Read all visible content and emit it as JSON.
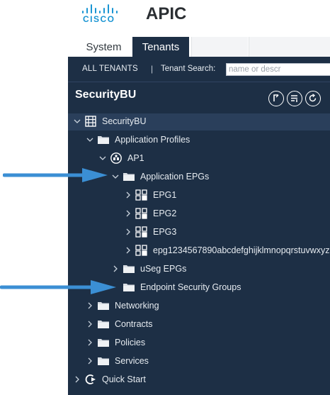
{
  "header": {
    "brand": "CISCO",
    "app_title": "APIC"
  },
  "tabs": [
    {
      "label": "System",
      "active": false
    },
    {
      "label": "Tenants",
      "active": true
    }
  ],
  "subbar": {
    "all_tenants": "ALL TENANTS",
    "separator": "|",
    "tenant_search_label": "Tenant Search:",
    "search_placeholder": "name or descr"
  },
  "panel": {
    "title": "SecurityBU",
    "actions": [
      "summary-icon",
      "list-icon",
      "refresh-icon"
    ]
  },
  "tree": {
    "root": {
      "label": "SecurityBU",
      "icon": "tenant-building-icon"
    },
    "application_profiles": {
      "label": "Application Profiles",
      "icon": "folder-icon"
    },
    "ap1": {
      "label": "AP1",
      "icon": "application-profile-icon"
    },
    "application_epgs": {
      "label": "Application EPGs",
      "icon": "folder-icon"
    },
    "epgs": [
      {
        "label": "EPG1",
        "icon": "epg-icon"
      },
      {
        "label": "EPG2",
        "icon": "epg-icon"
      },
      {
        "label": "EPG3",
        "icon": "epg-icon"
      },
      {
        "label": "epg1234567890abcdefghijklmnopqrstuvwxyz",
        "icon": "epg-icon"
      }
    ],
    "useg_epgs": {
      "label": "uSeg EPGs",
      "icon": "folder-icon"
    },
    "endpoint_security_groups": {
      "label": "Endpoint Security Groups",
      "icon": "folder-icon"
    },
    "networking": {
      "label": "Networking",
      "icon": "folder-icon"
    },
    "contracts": {
      "label": "Contracts",
      "icon": "folder-icon"
    },
    "policies": {
      "label": "Policies",
      "icon": "folder-icon"
    },
    "services": {
      "label": "Services",
      "icon": "folder-icon"
    },
    "quick_start": {
      "label": "Quick Start",
      "icon": "quick-start-icon"
    }
  },
  "colors": {
    "brand_blue": "#1a95d3",
    "panel_bg": "#1d2f45",
    "callout_arrow": "#3b8fd4"
  }
}
